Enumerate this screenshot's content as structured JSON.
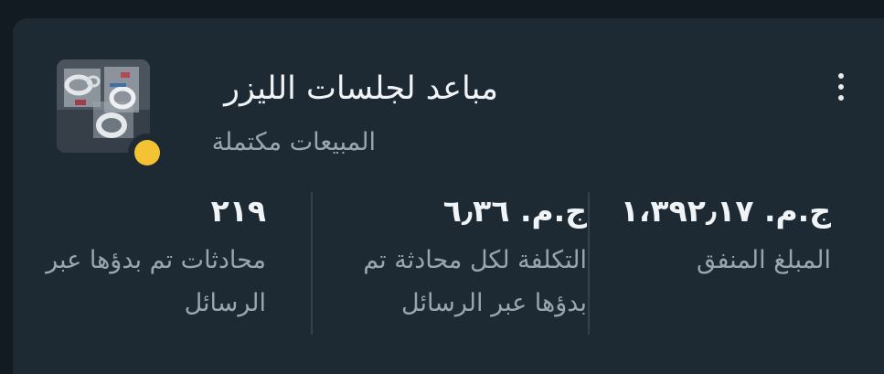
{
  "header": {
    "title": "مباعد لجلسات الليزر",
    "subtitle": "المبيعات مكتملة",
    "status_color": "#f3c333",
    "menu_icon": "more-vertical-icon"
  },
  "metrics": [
    {
      "value": "ج.م. ١،٣٩٢٫١٧",
      "label": "المبلغ المنفق"
    },
    {
      "value": "ج.م. ٦٫٣٦",
      "label": "التكلفة لكل محادثة تم بدؤها عبر الرسائل"
    },
    {
      "value": "٢١٩",
      "label": "محادثات تم بدؤها عبر الرسائل"
    }
  ]
}
